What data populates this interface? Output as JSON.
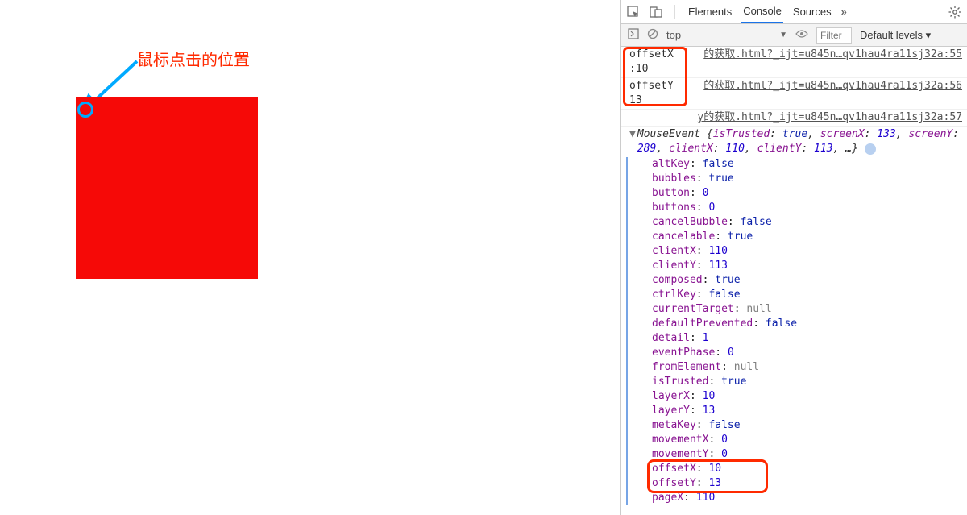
{
  "page": {
    "annotation": "鼠标点击的位置"
  },
  "devtools": {
    "tabs": {
      "elements": "Elements",
      "console": "Console",
      "sources": "Sources",
      "more": "»"
    },
    "toolbar": {
      "context": "top",
      "filter_placeholder": "Filter",
      "levels": "Default levels ▾"
    },
    "logs": {
      "offsetX_label": "offsetX\n:10",
      "offsetY_label": "offsetY\n13",
      "src1": "的获取.html?_ijt=u845n…qv1hau4ra11sj32a:55",
      "src2": "的获取.html?_ijt=u845n…qv1hau4ra11sj32a:56",
      "src3": "y的获取.html?_ijt=u845n…qv1hau4ra11sj32a:57"
    },
    "event_header": {
      "class": "MouseEvent",
      "preview": " {isTrusted: true, screenX: 133, screenY: 289, clientX: 110, clientY: 113, …}"
    },
    "props": [
      {
        "k": "altKey",
        "v": "false",
        "t": "kw"
      },
      {
        "k": "bubbles",
        "v": "true",
        "t": "kw"
      },
      {
        "k": "button",
        "v": "0",
        "t": "num"
      },
      {
        "k": "buttons",
        "v": "0",
        "t": "num"
      },
      {
        "k": "cancelBubble",
        "v": "false",
        "t": "kw"
      },
      {
        "k": "cancelable",
        "v": "true",
        "t": "kw"
      },
      {
        "k": "clientX",
        "v": "110",
        "t": "num"
      },
      {
        "k": "clientY",
        "v": "113",
        "t": "num"
      },
      {
        "k": "composed",
        "v": "true",
        "t": "kw"
      },
      {
        "k": "ctrlKey",
        "v": "false",
        "t": "kw"
      },
      {
        "k": "currentTarget",
        "v": "null",
        "t": "null"
      },
      {
        "k": "defaultPrevented",
        "v": "false",
        "t": "kw"
      },
      {
        "k": "detail",
        "v": "1",
        "t": "num"
      },
      {
        "k": "eventPhase",
        "v": "0",
        "t": "num"
      },
      {
        "k": "fromElement",
        "v": "null",
        "t": "null"
      },
      {
        "k": "isTrusted",
        "v": "true",
        "t": "kw"
      },
      {
        "k": "layerX",
        "v": "10",
        "t": "num"
      },
      {
        "k": "layerY",
        "v": "13",
        "t": "num"
      },
      {
        "k": "metaKey",
        "v": "false",
        "t": "kw"
      },
      {
        "k": "movementX",
        "v": "0",
        "t": "num"
      },
      {
        "k": "movementY",
        "v": "0",
        "t": "num"
      },
      {
        "k": "offsetX",
        "v": "10",
        "t": "num"
      },
      {
        "k": "offsetY",
        "v": "13",
        "t": "num"
      },
      {
        "k": "pageX",
        "v": "110",
        "t": "num"
      }
    ]
  }
}
